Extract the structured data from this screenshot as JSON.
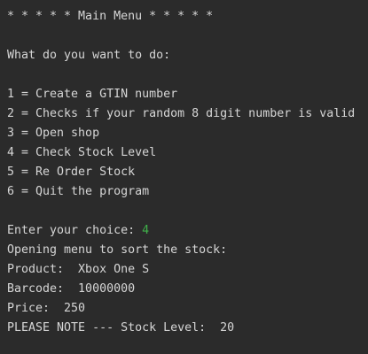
{
  "console": {
    "menu_title": "* * * * * Main Menu * * * * *",
    "prompt_question": "What do you want to do:",
    "menu_options": [
      "1 = Create a GTIN number",
      "2 = Checks if your random 8 digit number is valid",
      "3 = Open shop",
      "4 = Check Stock Level",
      "5 = Re Order Stock",
      "6 = Quit the program"
    ],
    "choice_prompt": "Enter your choice: ",
    "choice_value": "4",
    "opening_message": "Opening menu to sort the stock:",
    "product_line": "Product:  Xbox One S",
    "barcode_line": "Barcode:  10000000",
    "price_line": "Price:  250",
    "stock_note": "PLEASE NOTE --- Stock Level:  20"
  },
  "colors": {
    "background": "#2b2b2b",
    "text": "#d6d6d6",
    "user_input": "#3fb04a"
  }
}
